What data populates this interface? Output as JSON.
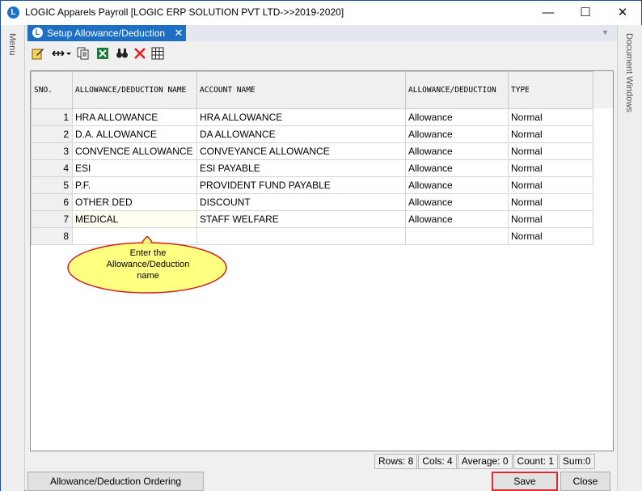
{
  "window": {
    "title": "LOGIC Apparels Payroll  [LOGIC ERP SOLUTION PVT LTD->>2019-2020]",
    "app_icon": "L",
    "minimize": "—",
    "maximize": "☐",
    "close": "✕"
  },
  "sidebars": {
    "left": "Menu",
    "right": "Document Windows"
  },
  "tab": {
    "label": "Setup Allowance/Deduction",
    "icon": "L",
    "close": "✕",
    "menu": "▼"
  },
  "toolbar": {
    "icons": [
      "edit-icon",
      "column-width-icon",
      "copy-icon",
      "excel-icon",
      "find-icon",
      "delete-icon",
      "grid-icon"
    ]
  },
  "grid": {
    "columns": [
      "SNO.",
      "ALLOWANCE/DEDUCTION NAME",
      "ACCOUNT NAME",
      "ALLOWANCE/DEDUCTION",
      "TYPE"
    ],
    "rows": [
      {
        "sno": "1",
        "name": "HRA ALLOWANCE",
        "account": "HRA ALLOWANCE",
        "kind": "Allowance",
        "type": "Normal"
      },
      {
        "sno": "2",
        "name": "D.A. ALLOWANCE",
        "account": "DA ALLOWANCE",
        "kind": "Allowance",
        "type": "Normal"
      },
      {
        "sno": "3",
        "name": "CONVENCE ALLOWANCE",
        "account": "CONVEYANCE ALLOWANCE",
        "kind": "Allowance",
        "type": "Normal"
      },
      {
        "sno": "4",
        "name": "ESI",
        "account": "ESI PAYABLE",
        "kind": "Allowance",
        "type": "Normal"
      },
      {
        "sno": "5",
        "name": "P.F.",
        "account": "PROVIDENT FUND PAYABLE",
        "kind": "Allowance",
        "type": "Normal"
      },
      {
        "sno": "6",
        "name": "OTHER DED",
        "account": "DISCOUNT",
        "kind": "Allowance",
        "type": "Normal"
      },
      {
        "sno": "7",
        "name": "MEDICAL",
        "account": "STAFF WELFARE",
        "kind": "Allowance",
        "type": "Normal"
      },
      {
        "sno": "8",
        "name": "",
        "account": "",
        "kind": "",
        "type": "Normal"
      }
    ]
  },
  "callout": {
    "line1": "Enter  the",
    "line2": "Allowance/Deduction",
    "line3": "name"
  },
  "status": {
    "rows": "Rows: 8",
    "cols": "Cols: 4",
    "average": "Average: 0",
    "count": "Count: 1",
    "sum": "Sum:0"
  },
  "buttons": {
    "ordering": "Allowance/Deduction Ordering",
    "save": "Save",
    "close": "Close"
  },
  "colors": {
    "accent": "#1c6fc2",
    "highlight_border": "#e0262f",
    "callout_fill": "#ffff80"
  }
}
